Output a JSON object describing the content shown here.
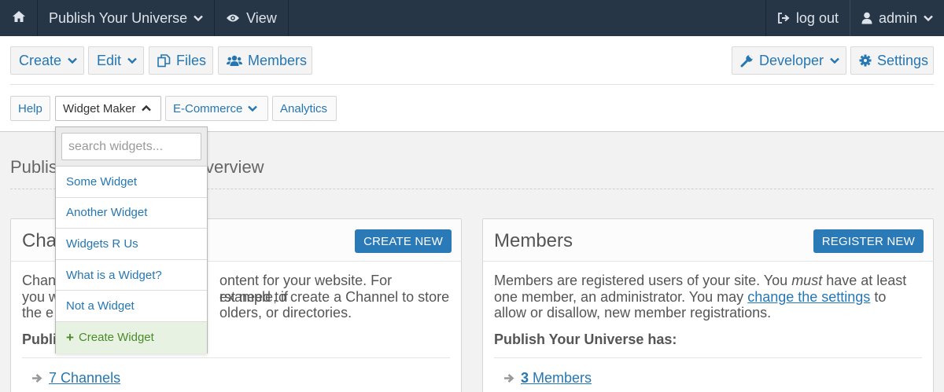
{
  "topbar": {
    "site_name": "Publish Your Universe",
    "view_label": "View",
    "logout_label": "log out",
    "user_label": "admin"
  },
  "toolbar": {
    "create_label": "Create",
    "edit_label": "Edit",
    "files_label": "Files",
    "members_label": "Members",
    "developer_label": "Developer",
    "settings_label": "Settings"
  },
  "subnav": {
    "help": "Help",
    "widget_maker": "Widget Maker",
    "ecommerce": "E-Commerce",
    "analytics": "Analytics"
  },
  "dropdown": {
    "search_placeholder": "search widgets...",
    "items": [
      "Some Widget",
      "Another Widget",
      "Widgets R Us",
      "What is a Widget?",
      "Not a Widget"
    ],
    "create_label": "Create Widget"
  },
  "page": {
    "title_start": "Publis",
    "title_end": "verview"
  },
  "channels_panel": {
    "title": "Cha",
    "button": "CREATE NEW",
    "line1_a": "Chan",
    "line1_b": "ontent for your website. For example, if",
    "line2_a": "you w",
    "line2_b": "rst need to create a Channel to store",
    "line3_a": "the e",
    "line3_b": "olders, or directories.",
    "has_label": "Publi",
    "count_link": "7 Channels"
  },
  "members_panel": {
    "title": "Members",
    "button": "REGISTER NEW",
    "text_1": "Members are registered users of your site. You ",
    "text_em": "must",
    "text_2": " have at least one member, an administrator. You may ",
    "link": "change the settings",
    "text_3": " to allow or disallow, new member registrations.",
    "has_label": "Publish Your Universe has:",
    "count_num": "3",
    "count_label": "Members"
  }
}
